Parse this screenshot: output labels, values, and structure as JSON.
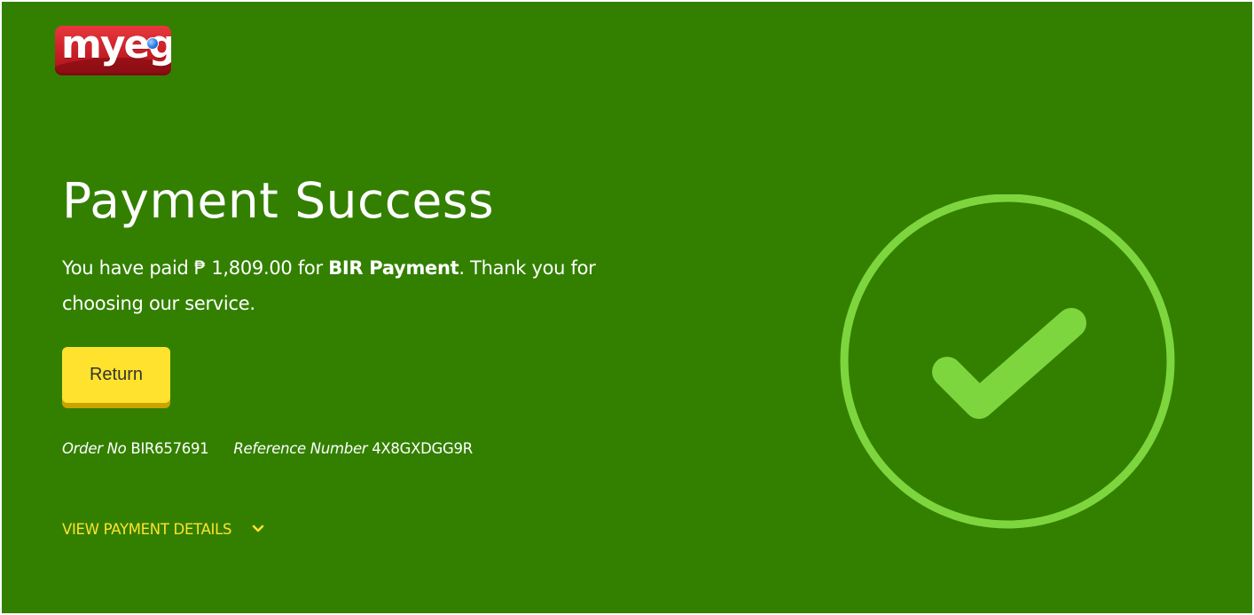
{
  "brand": {
    "logo_text": "myeg"
  },
  "header": {
    "title": "Payment Success"
  },
  "message": {
    "prefix": "You have paid ₱ 1,809.00 for ",
    "service": "BIR Payment",
    "suffix": ". Thank you for choosing our service."
  },
  "actions": {
    "return_label": "Return"
  },
  "order": {
    "order_no_label": "Order No",
    "order_no_value": "BIR657691",
    "reference_label": "Reference Number",
    "reference_value": "4X8GXDGG9R"
  },
  "details": {
    "toggle_label": "VIEW PAYMENT DETAILS",
    "toggle_icon": "chevron-down-icon"
  },
  "status_icon": "check-circle-icon",
  "colors": {
    "background": "#338000",
    "accent": "#ffe22e",
    "check": "#7ed63f",
    "logo_red": "#c81e26"
  }
}
